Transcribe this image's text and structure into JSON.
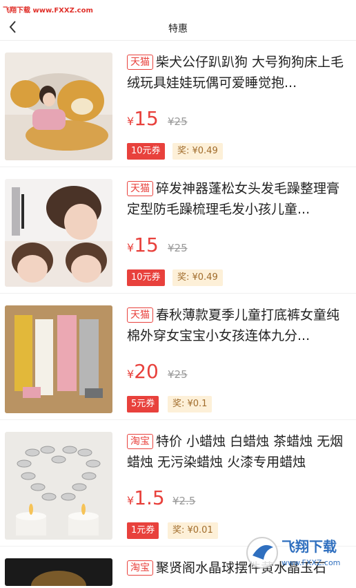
{
  "watermark": "飞翔下载 www.FXXZ.com",
  "header": {
    "title": "特惠"
  },
  "items": [
    {
      "source": "天猫",
      "title": "柴犬公仔趴趴狗 大号狗狗床上毛绒玩具娃娃玩偶可爱睡觉抱...",
      "yen": "¥",
      "price": "15",
      "orig": "¥25",
      "coupon": "10元券",
      "reward": "奖: ¥0.49"
    },
    {
      "source": "天猫",
      "title": "碎发神器蓬松女头发毛躁整理膏定型防毛躁梳理毛发小孩儿童...",
      "yen": "¥",
      "price": "15",
      "orig": "¥25",
      "coupon": "10元券",
      "reward": "奖: ¥0.49"
    },
    {
      "source": "天猫",
      "title": "春秋薄款夏季儿童打底裤女童纯棉外穿女宝宝小女孩连体九分...",
      "yen": "¥",
      "price": "20",
      "orig": "¥25",
      "coupon": "5元券",
      "reward": "奖: ¥0.1"
    },
    {
      "source": "淘宝",
      "title": "特价 小蜡烛 白蜡烛 茶蜡烛 无烟蜡烛 无污染蜡烛 火漆专用蜡烛",
      "yen": "¥",
      "price": "1.5",
      "orig": "¥2.5",
      "coupon": "1元券",
      "reward": "奖: ¥0.01"
    },
    {
      "source": "淘宝",
      "title": "聚贤阁水晶球摆件黄水晶玉石",
      "yen": "",
      "price": "",
      "orig": "",
      "coupon": "",
      "reward": ""
    }
  ],
  "footer_watermark": {
    "brand": "飞翔下载",
    "site": "www.FXXZ.com"
  },
  "colors": {
    "accent": "#e8413c",
    "reward_bg": "#fdf0d8",
    "reward_text": "#a06b2a"
  }
}
